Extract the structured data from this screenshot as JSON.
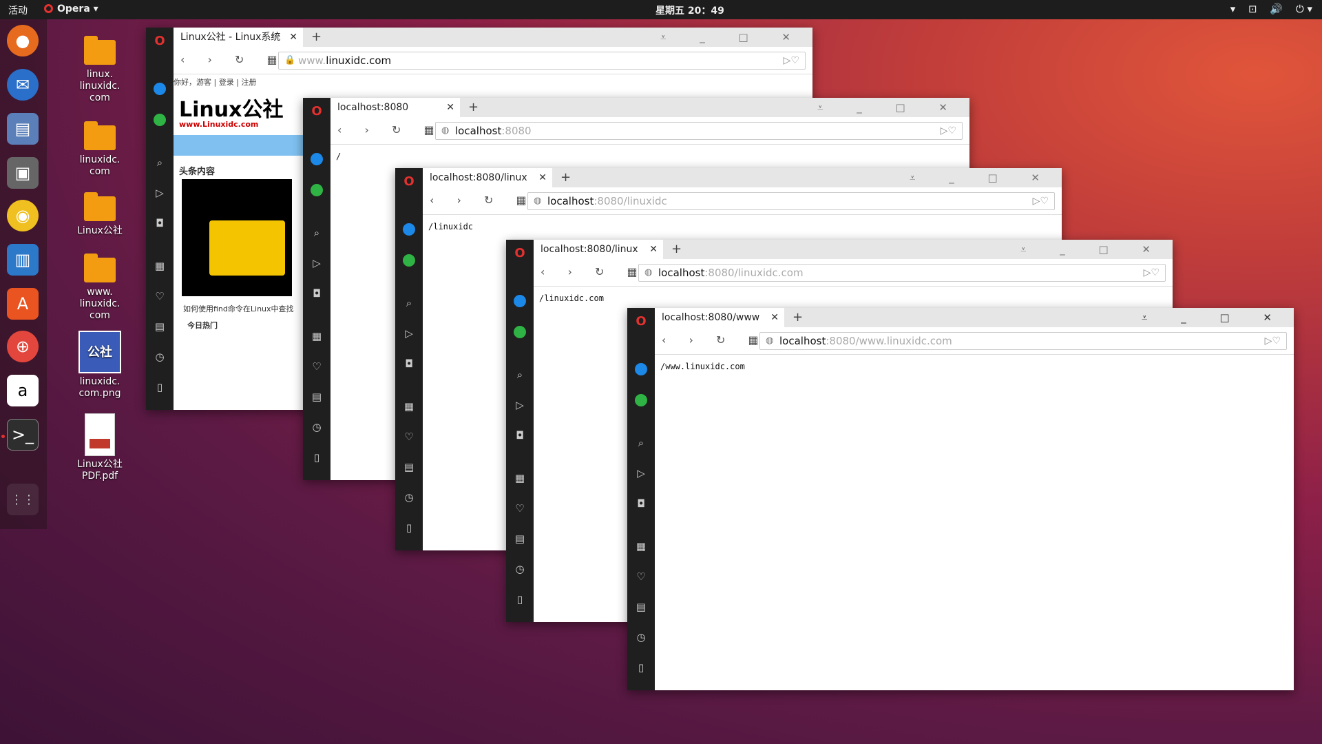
{
  "topbar": {
    "activities": "活动",
    "app": "Opera",
    "clock": "星期五 20：49",
    "tray": [
      "▾",
      "⊡",
      "🔊",
      "⏻ ▾"
    ]
  },
  "desktop": {
    "icons": [
      {
        "label": "linux.\nlinuxidc.\ncom",
        "type": "folder"
      },
      {
        "label": "linuxidc.\ncom",
        "type": "folder"
      },
      {
        "label": "Linux公社",
        "type": "folder"
      },
      {
        "label": "www.\nlinuxidc.\ncom",
        "type": "folder"
      },
      {
        "label": "linuxidc.\ncom.png",
        "type": "image",
        "thumb": "公社"
      },
      {
        "label": "Linux公社\nPDF.pdf",
        "type": "pdf"
      }
    ]
  },
  "windows": [
    {
      "tab_title": "Linux公社 - Linux系统",
      "url_host": "www.linuxidc.com",
      "url_prefix": "www.",
      "url_rest": "linuxidc.com",
      "site": {
        "top_links": "你好，游客  |  登录  |  注册",
        "logo": "Linux公社",
        "logo_sub": "www.Linuxidc.com",
        "section": "头条内容",
        "caption": "如何使用find命令在Linux中查找",
        "hot": "今日热门"
      }
    },
    {
      "tab_title": "localhost:8080",
      "url_host": "localhost",
      "url_rest": ":8080",
      "body": "/"
    },
    {
      "tab_title": "localhost:8080/linux",
      "url_host": "localhost",
      "url_rest": ":8080/linuxidc",
      "body": "/linuxidc"
    },
    {
      "tab_title": "localhost:8080/linux",
      "url_host": "localhost",
      "url_rest": ":8080/linuxidc.com",
      "body": "/linuxidc.com"
    },
    {
      "tab_title": "localhost:8080/www",
      "url_host": "localhost",
      "url_rest": ":8080/www.linuxidc.com",
      "body": "/www.linuxidc.com"
    }
  ],
  "ui": {
    "tab_close": "✕",
    "new_tab": "+",
    "win_controls": "⩡ _ □ ✕",
    "nav": "‹ › ↻ ▦",
    "url_right": "▷♡",
    "sidebar_icons": [
      "search-icon",
      "send-icon",
      "camera-icon",
      "grid-icon",
      "heart-icon",
      "news-icon",
      "history-icon",
      "panel-icon"
    ]
  }
}
